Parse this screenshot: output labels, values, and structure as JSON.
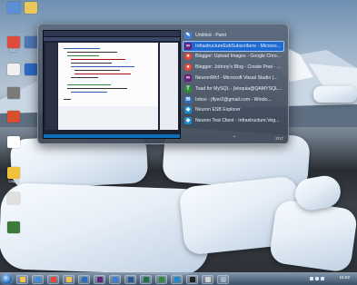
{
  "desktop": {
    "icons": [
      {
        "label": "",
        "color": "#5b8fd6"
      },
      {
        "label": "",
        "color": "#e9c75a"
      },
      {
        "label": "RSC",
        "color": "#e04a3a"
      },
      {
        "label": "",
        "color": "#4e78b6"
      },
      {
        "label": "",
        "color": "#f0f0f0"
      },
      {
        "label": "",
        "color": "#2d6bc7"
      },
      {
        "label": "",
        "color": "#7a7a7a"
      },
      {
        "label": "",
        "color": "#d74f2d"
      },
      {
        "label": "",
        "color": "#ffffff"
      },
      {
        "label": "City of",
        "color": "#f0c23c"
      },
      {
        "label": "",
        "color": "#e0e0e0"
      },
      {
        "label": "",
        "color": "#3b7a3a"
      }
    ]
  },
  "switcher": {
    "windows": [
      {
        "label": "Untitled - Paint",
        "icon": "paint-icon",
        "color": "#3c7fd3",
        "glyph": "✎"
      },
      {
        "label": "InfrastructureEsbSubscribers - Microso...",
        "icon": "visual-studio-icon",
        "color": "#68217a",
        "glyph": "∞",
        "selected": true
      },
      {
        "label": "Blogger: Upload Images - Google Chro...",
        "icon": "chrome-icon",
        "color": "#e9463a",
        "glyph": "●"
      },
      {
        "label": "Blogger: Johnny's Blog - Create Post - ...",
        "icon": "chrome-icon",
        "color": "#e9463a",
        "glyph": "●"
      },
      {
        "label": "NeuronWcf - Microsoft Visual Studio (...",
        "icon": "visual-studio-icon",
        "color": "#68217a",
        "glyph": "∞"
      },
      {
        "label": "Toad for MySQL - [eloquia@QAMYSQL...",
        "icon": "toad-icon",
        "color": "#2f8a3a",
        "glyph": "T"
      },
      {
        "label": "Inbox - jflyer2@gmail.com - Windo...",
        "icon": "mail-icon",
        "color": "#2b6fbf",
        "glyph": "✉"
      },
      {
        "label": "Neuron ESB Explorer",
        "icon": "neuron-icon",
        "color": "#1b8bd0",
        "glyph": "◆"
      },
      {
        "label": "Neuron Test Client - Infrastructure.Veg...",
        "icon": "neuron-icon",
        "color": "#1b8bd0",
        "glyph": "◆"
      }
    ],
    "more_indicator": "⌄",
    "counter": "2/17"
  },
  "taskbar": {
    "items": [
      {
        "icon": "explorer-icon",
        "color": "#f2c14e"
      },
      {
        "icon": "ie-icon",
        "color": "#3a8ee6"
      },
      {
        "icon": "chrome-icon",
        "color": "#e9463a"
      },
      {
        "icon": "folder-icon",
        "color": "#f2c14e"
      },
      {
        "icon": "outlook-icon",
        "color": "#2b6fbf"
      },
      {
        "icon": "visual-studio-icon",
        "color": "#68217a"
      },
      {
        "icon": "paint-icon",
        "color": "#3c7fd3"
      },
      {
        "icon": "word-icon",
        "color": "#2b5797"
      },
      {
        "icon": "excel-icon",
        "color": "#1f7244"
      },
      {
        "icon": "toad-icon",
        "color": "#2f8a3a"
      },
      {
        "icon": "neuron-icon",
        "color": "#1b8bd0"
      },
      {
        "icon": "cmd-icon",
        "color": "#222222"
      },
      {
        "icon": "app-icon",
        "color": "#d0d0d0"
      },
      {
        "icon": "app-icon",
        "color": "#9fb4cc"
      }
    ],
    "clock_time": "16:02",
    "clock_date": ""
  }
}
